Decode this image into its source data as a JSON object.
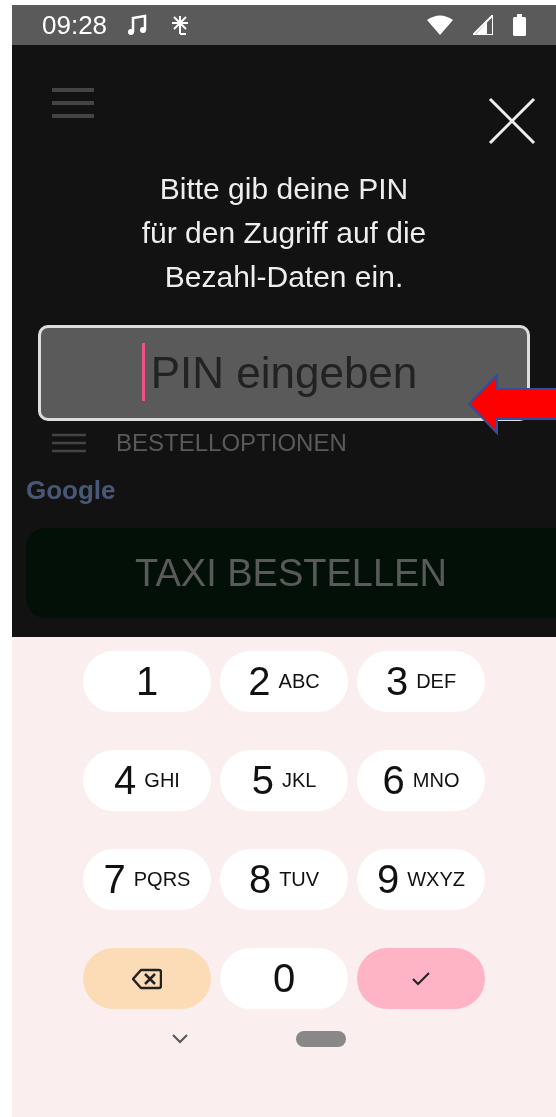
{
  "status_bar": {
    "time": "09:28"
  },
  "background": {
    "options_label": "BESTELLOPTIONEN",
    "map_attribution": "Google",
    "order_button": "TAXI BESTELLEN"
  },
  "dialog": {
    "message": "Bitte gib deine PIN\nfür den Zugriff auf die\nBezahl-Daten ein.",
    "pin_field": {
      "placeholder": "PIN eingeben",
      "focused": true
    }
  },
  "keypad": {
    "keys": [
      {
        "kind": "digit",
        "digit": "1"
      },
      {
        "kind": "digit",
        "digit": "2",
        "letters": "ABC"
      },
      {
        "kind": "digit",
        "digit": "3",
        "letters": "DEF"
      },
      {
        "kind": "digit",
        "digit": "4",
        "letters": "GHI"
      },
      {
        "kind": "digit",
        "digit": "5",
        "letters": "JKL"
      },
      {
        "kind": "digit",
        "digit": "6",
        "letters": "MNO"
      },
      {
        "kind": "digit",
        "digit": "7",
        "letters": "PQRS"
      },
      {
        "kind": "digit",
        "digit": "8",
        "letters": "TUV"
      },
      {
        "kind": "digit",
        "digit": "9",
        "letters": "WXYZ"
      },
      {
        "kind": "backspace"
      },
      {
        "kind": "digit",
        "digit": "0"
      },
      {
        "kind": "confirm"
      }
    ]
  }
}
